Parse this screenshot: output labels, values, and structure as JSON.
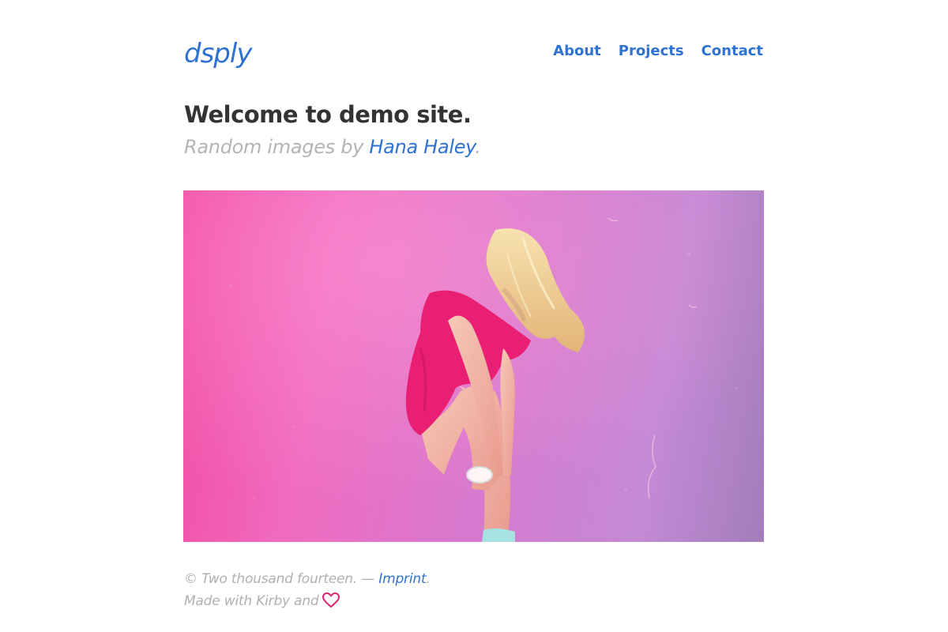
{
  "header": {
    "logo": "dsply",
    "nav": [
      "About",
      "Projects",
      "Contact"
    ]
  },
  "intro": {
    "title": "Welcome to demo site.",
    "subtitle_prefix": "Random images by ",
    "author_link": "Hana Haley",
    "subtitle_suffix": "."
  },
  "hero_image": {
    "description": "",
    "icon": "photo-icon"
  },
  "footer": {
    "copyright_prefix": "© Two thousand fourteen. — ",
    "imprint_link": "Imprint",
    "imprint_suffix": ".",
    "made_with": "Made with Kirby and",
    "heart_icon": "heart-icon"
  },
  "colors": {
    "link": "#2f72d0",
    "heading": "#333333",
    "muted": "#b4b4b4",
    "heart": "#d6246e"
  }
}
